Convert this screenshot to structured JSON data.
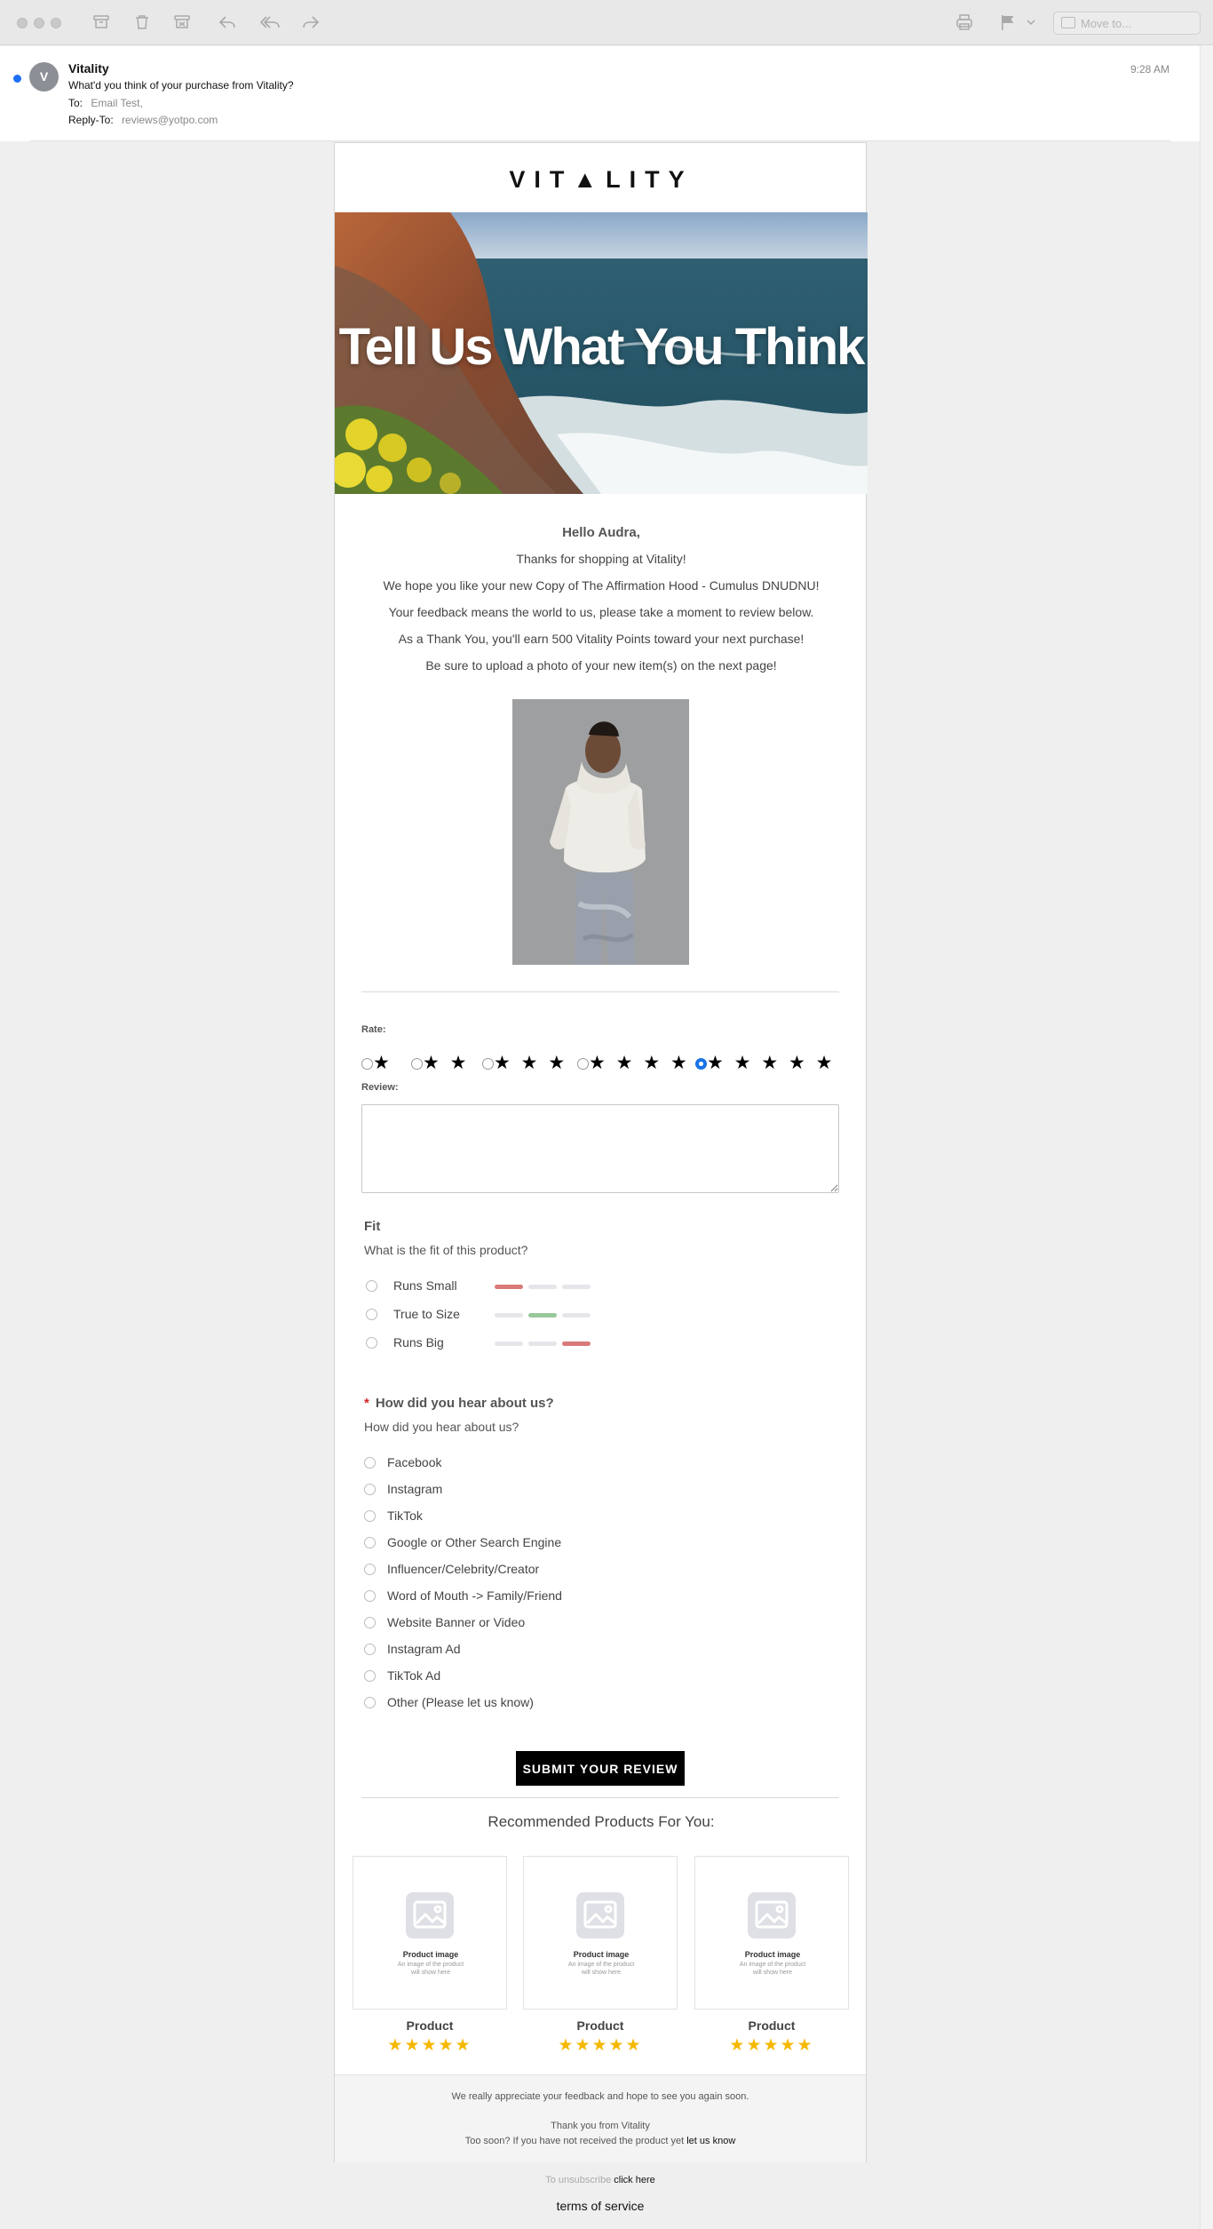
{
  "toolbar": {
    "move_placeholder": "Move to...",
    "icons": [
      "archive-icon",
      "trash-icon",
      "junk-icon",
      "reply-icon",
      "reply-all-icon",
      "forward-icon",
      "print-icon",
      "flag-icon",
      "chevron-down-icon"
    ]
  },
  "message": {
    "avatar_letter": "V",
    "sender": "Vitality",
    "subject": "What'd you think of your purchase from Vitality?",
    "to_label": "To:",
    "to_value": "Email Test,",
    "reply_label": "Reply-To:",
    "reply_value": "reviews@yotpo.com",
    "time": "9:28 AM"
  },
  "email": {
    "logo": "VIT▲LITY",
    "hero_title": "Tell Us What You Think",
    "greeting": "Hello Audra,",
    "lines": [
      "Thanks for shopping at Vitality!",
      "We hope you like your new Copy of The Affirmation Hood - Cumulus DNUDNU!",
      "Your feedback means the world to us, please take a moment to review below.",
      "As a Thank You, you'll earn 500 Vitality Points toward your next purchase!",
      "Be sure to upload a photo of your new item(s) on the next page!"
    ],
    "rate_label": "Rate:",
    "rating_options": [
      {
        "stars": "★",
        "selected": false
      },
      {
        "stars": "★ ★",
        "selected": false
      },
      {
        "stars": "★ ★ ★",
        "selected": false
      },
      {
        "stars": "★ ★ ★ ★",
        "selected": false
      },
      {
        "stars": "★ ★ ★ ★ ★",
        "selected": true
      }
    ],
    "review_label": "Review:",
    "fit": {
      "title": "Fit",
      "question": "What is the fit of this product?",
      "options": [
        "Runs Small",
        "True to Size",
        "Runs Big"
      ]
    },
    "hear": {
      "required_mark": "*",
      "title": "How did you hear about us?",
      "question": "How did you hear about us?",
      "options": [
        "Facebook",
        "Instagram",
        "TikTok",
        "Google or Other Search Engine",
        "Influencer/Celebrity/Creator",
        "Word of Mouth -> Family/Friend",
        "Website Banner or Video",
        "Instagram Ad",
        "TikTok Ad",
        "Other (Please let us know)"
      ]
    },
    "submit_label": "SUBMIT YOUR REVIEW",
    "recommended_title": "Recommended Products For You:",
    "products": [
      {
        "img_title": "Product image",
        "img_desc": "An image of the product will show here",
        "name": "Product",
        "stars": "★★★★★"
      },
      {
        "img_title": "Product image",
        "img_desc": "An image of the product will show here",
        "name": "Product",
        "stars": "★★★★★"
      },
      {
        "img_title": "Product image",
        "img_desc": "An image of the product will show here",
        "name": "Product",
        "stars": "★★★★★"
      }
    ],
    "footer": {
      "line1": "We really appreciate your feedback and hope to see you again soon.",
      "line2": "Thank you from Vitality",
      "line3": "Too soon? If you have not received the product yet",
      "line3_link": "let us know"
    }
  },
  "below": {
    "unsub_text": "To unsubscribe",
    "unsub_link": "click here",
    "tos": "terms of service"
  },
  "colors": {
    "unread": "#1e6ff5",
    "radio_selected": "#1a73e8",
    "required": "#d0262b",
    "star_gold": "#f5b800",
    "bar_red": "#d97a7a",
    "bar_green": "#98c89a"
  }
}
